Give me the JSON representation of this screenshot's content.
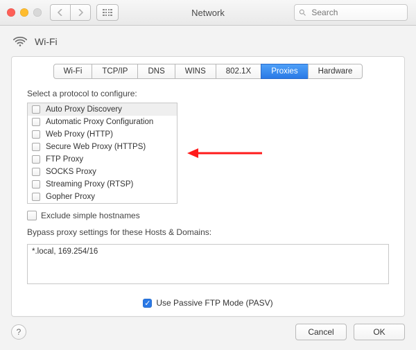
{
  "window": {
    "title": "Network"
  },
  "search": {
    "placeholder": "Search"
  },
  "panel": {
    "title": "Wi-Fi"
  },
  "tabs": [
    {
      "label": "Wi-Fi",
      "active": false
    },
    {
      "label": "TCP/IP",
      "active": false
    },
    {
      "label": "DNS",
      "active": false
    },
    {
      "label": "WINS",
      "active": false
    },
    {
      "label": "802.1X",
      "active": false
    },
    {
      "label": "Proxies",
      "active": true
    },
    {
      "label": "Hardware",
      "active": false
    }
  ],
  "proxies": {
    "select_label": "Select a protocol to configure:",
    "protocols": [
      {
        "label": "Auto Proxy Discovery",
        "checked": false,
        "selected": true
      },
      {
        "label": "Automatic Proxy Configuration",
        "checked": false,
        "selected": false
      },
      {
        "label": "Web Proxy (HTTP)",
        "checked": false,
        "selected": false
      },
      {
        "label": "Secure Web Proxy (HTTPS)",
        "checked": false,
        "selected": false
      },
      {
        "label": "FTP Proxy",
        "checked": false,
        "selected": false
      },
      {
        "label": "SOCKS Proxy",
        "checked": false,
        "selected": false
      },
      {
        "label": "Streaming Proxy (RTSP)",
        "checked": false,
        "selected": false
      },
      {
        "label": "Gopher Proxy",
        "checked": false,
        "selected": false
      }
    ],
    "exclude_label": "Exclude simple hostnames",
    "exclude_checked": false,
    "bypass_label": "Bypass proxy settings for these Hosts & Domains:",
    "bypass_value": "*.local, 169.254/16",
    "pasv_label": "Use Passive FTP Mode (PASV)",
    "pasv_checked": true
  },
  "buttons": {
    "cancel": "Cancel",
    "ok": "OK"
  }
}
